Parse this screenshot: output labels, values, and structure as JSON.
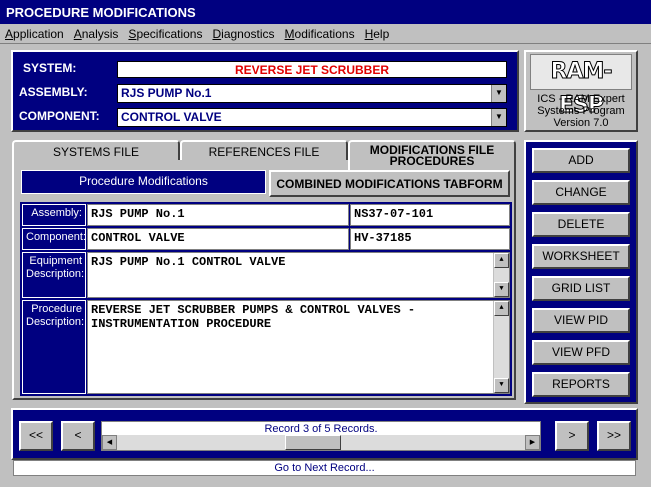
{
  "window": {
    "title": "PROCEDURE MODIFICATIONS"
  },
  "menu": [
    {
      "label": "Application",
      "u": "A",
      "rest": "pplication"
    },
    {
      "label": "Analysis",
      "u": "A",
      "rest": "nalysis"
    },
    {
      "label": "Specifications",
      "u": "S",
      "rest": "pecifications"
    },
    {
      "label": "Diagnostics",
      "u": "D",
      "rest": "iagnostics"
    },
    {
      "label": "Modifications",
      "u": "M",
      "rest": "odifications"
    },
    {
      "label": "Help",
      "u": "H",
      "rest": "elp"
    }
  ],
  "header": {
    "system_label": "SYSTEM:",
    "system_value": "REVERSE JET SCRUBBER",
    "assembly_label": "ASSEMBLY:",
    "assembly_value": "RJS PUMP No.1",
    "component_label": "COMPONENT:",
    "component_value": "CONTROL VALVE"
  },
  "logo": {
    "text": "RAM-ESP",
    "line1": "ICS - RAM Expert",
    "line2": "Systems Program",
    "line3": "Version 7.0"
  },
  "tabs": {
    "systems": "SYSTEMS FILE",
    "references": "REFERENCES FILE",
    "modifications_line1": "MODIFICATIONS FILE",
    "modifications_line2": "PROCEDURES"
  },
  "panel": {
    "caption": "Procedure Modifications",
    "combined_button": "COMBINED MODIFICATIONS TABFORM",
    "assembly_label": "Assembly:",
    "assembly_value": "RJS PUMP No.1",
    "assembly_code": "NS37-07-101",
    "component_label": "Component:",
    "component_value": "CONTROL VALVE",
    "component_code": "HV-37185",
    "equip_label_1": "Equipment",
    "equip_label_2": "Description:",
    "equip_value": "RJS PUMP No.1 CONTROL VALVE",
    "proc_label_1": "Procedure",
    "proc_label_2": "Description:",
    "proc_value_1": "REVERSE JET SCRUBBER PUMPS & CONTROL VALVES -",
    "proc_value_2": "INSTRUMENTATION PROCEDURE"
  },
  "side_buttons": [
    "ADD",
    "CHANGE",
    "DELETE",
    "WORKSHEET",
    "GRID LIST",
    "VIEW PID",
    "VIEW PFD",
    "REPORTS"
  ],
  "nav": {
    "first": "<<",
    "prev": "<",
    "next": ">",
    "last": ">>",
    "record_text": "Record 3 of 5 Records.",
    "status": "Go to Next Record..."
  }
}
